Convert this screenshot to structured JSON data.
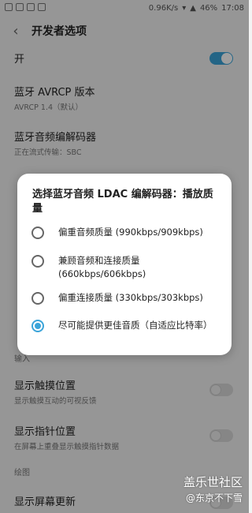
{
  "status": {
    "net_speed": "0.96K/s",
    "battery": "46%",
    "time": "17:08"
  },
  "appbar": {
    "title": "开发者选项"
  },
  "master": {
    "label": "开"
  },
  "rows": [
    {
      "title": "蓝牙 AVRCP 版本",
      "sub": "AVRCP 1.4（默认）"
    },
    {
      "title": "蓝牙音频编解码器",
      "sub": "正在流式传输：SBC"
    }
  ],
  "input_section": "输入",
  "rows2": [
    {
      "title": "显示触摸位置",
      "sub": "显示触摸互动的可视反馈"
    },
    {
      "title": "显示指针位置",
      "sub": "在屏幕上重叠显示触摸指针数据"
    }
  ],
  "draw_section": "绘图",
  "rows3": [
    {
      "title": "显示屏幕更新"
    }
  ],
  "dialog": {
    "title": "选择蓝牙音频 LDAC 编解码器：播放质量",
    "options": [
      {
        "label": "偏重音频质量 (990kbps/909kbps)",
        "selected": false
      },
      {
        "label": "兼顾音频和连接质量 (660kbps/606kbps)",
        "selected": false
      },
      {
        "label": "偏重连接质量 (330kbps/303kbps)",
        "selected": false
      },
      {
        "label": "尽可能提供更佳音质（自适应比特率）",
        "selected": true
      }
    ]
  },
  "watermark": {
    "line1": "盖乐世社区",
    "line2": "@东京不下雪"
  },
  "colors": {
    "accent": "#3ba4d9"
  }
}
